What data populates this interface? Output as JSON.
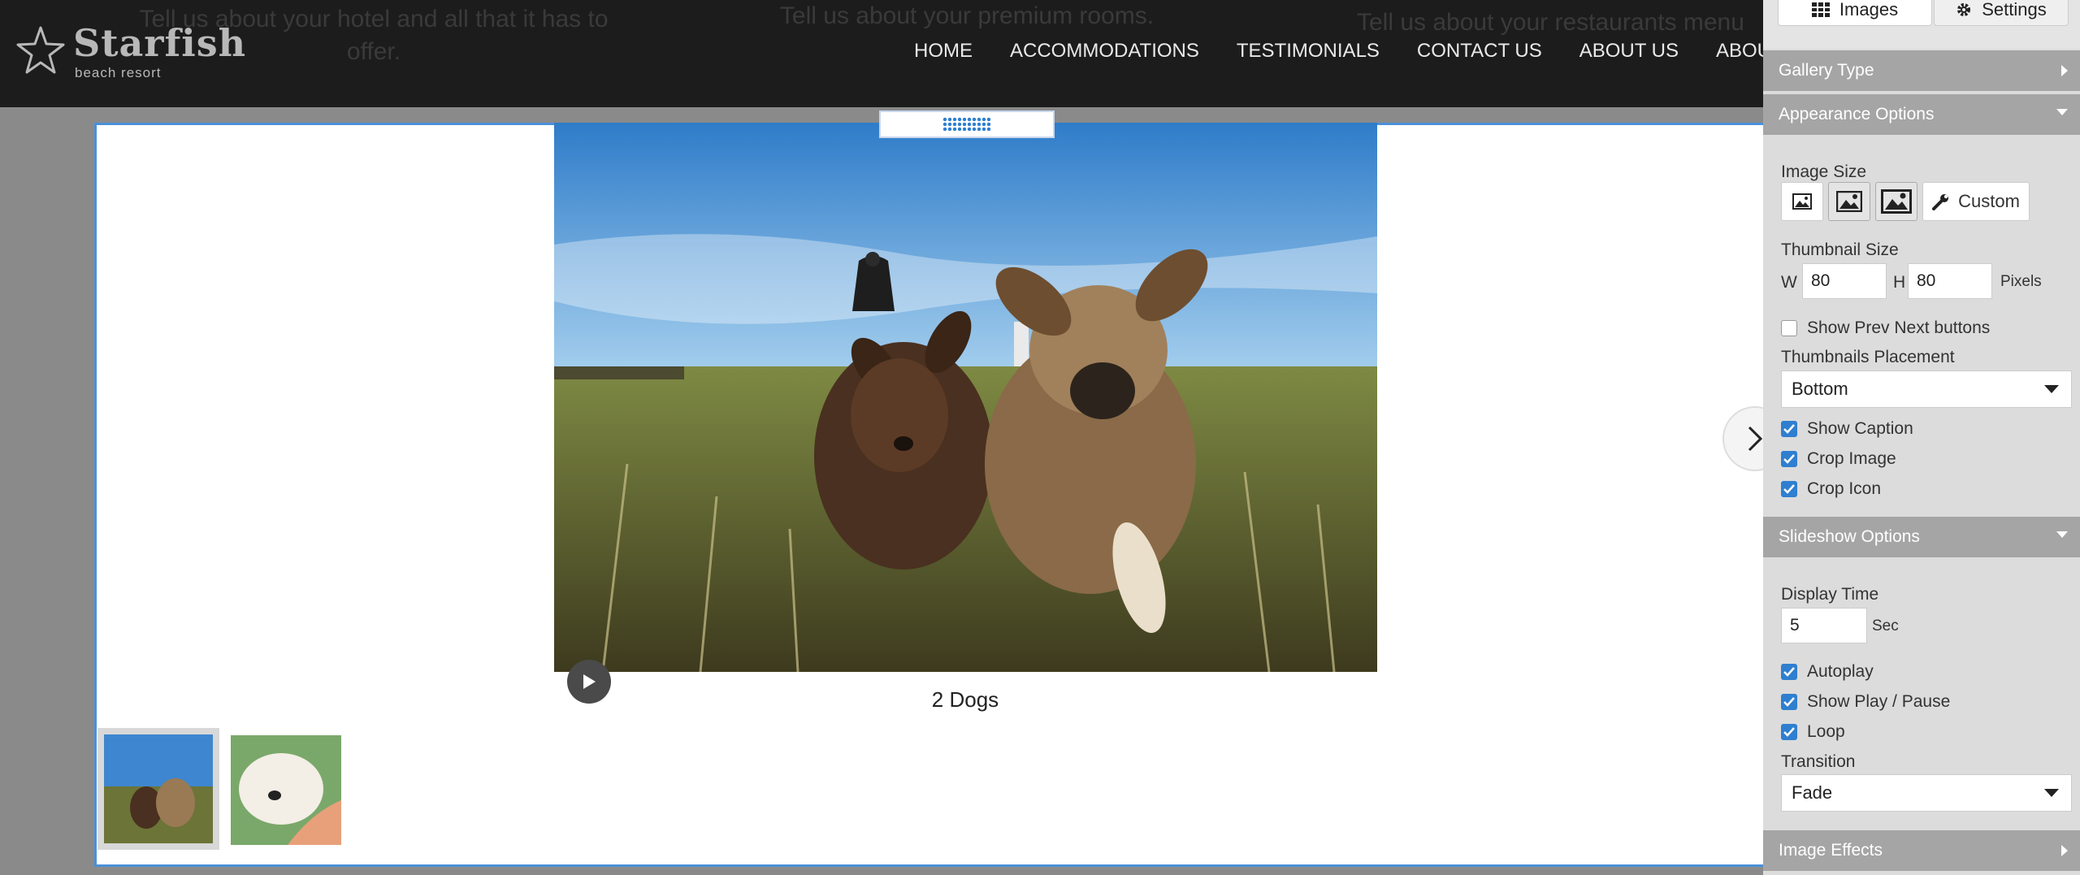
{
  "header": {
    "background_copy": [
      "Tell us about your hotel and all that it has to offer.",
      "Tell us about your premium rooms.",
      "Tell us about your restaurants menu"
    ],
    "logo": {
      "name": "Starfish",
      "tagline": "beach resort"
    },
    "nav": [
      "HOME",
      "ACCOMMODATIONS",
      "TESTIMONIALS",
      "CONTACT US",
      "ABOUT US",
      "ABOUT U"
    ]
  },
  "gallery": {
    "caption": "2 Dogs",
    "thumbnails": [
      "2 Dogs",
      "White puppy"
    ]
  },
  "panel": {
    "tabs": {
      "images": "Images",
      "settings": "Settings"
    },
    "sections": {
      "gallery_type": "Gallery Type",
      "appearance": "Appearance Options",
      "slideshow": "Slideshow Options",
      "effects": "Image Effects"
    },
    "appearance": {
      "image_size_label": "Image Size",
      "custom_label": "Custom",
      "thumb_size_label": "Thumbnail Size",
      "w_label": "W",
      "w_value": "80",
      "h_label": "H",
      "h_value": "80",
      "unit": "Pixels",
      "show_prev_next": "Show Prev Next buttons",
      "placement_label": "Thumbnails Placement",
      "placement_value": "Bottom",
      "show_caption": "Show Caption",
      "crop_image": "Crop Image",
      "crop_icon": "Crop Icon"
    },
    "slideshow": {
      "display_time_label": "Display Time",
      "display_time_value": "5",
      "unit": "Sec",
      "autoplay": "Autoplay",
      "show_play_pause": "Show Play / Pause",
      "loop": "Loop",
      "transition_label": "Transition",
      "transition_value": "Fade"
    }
  },
  "colors": {
    "accent": "#2f7fd0",
    "header_bg": "#1c1c1c",
    "section_bar": "#a5a5a5"
  }
}
